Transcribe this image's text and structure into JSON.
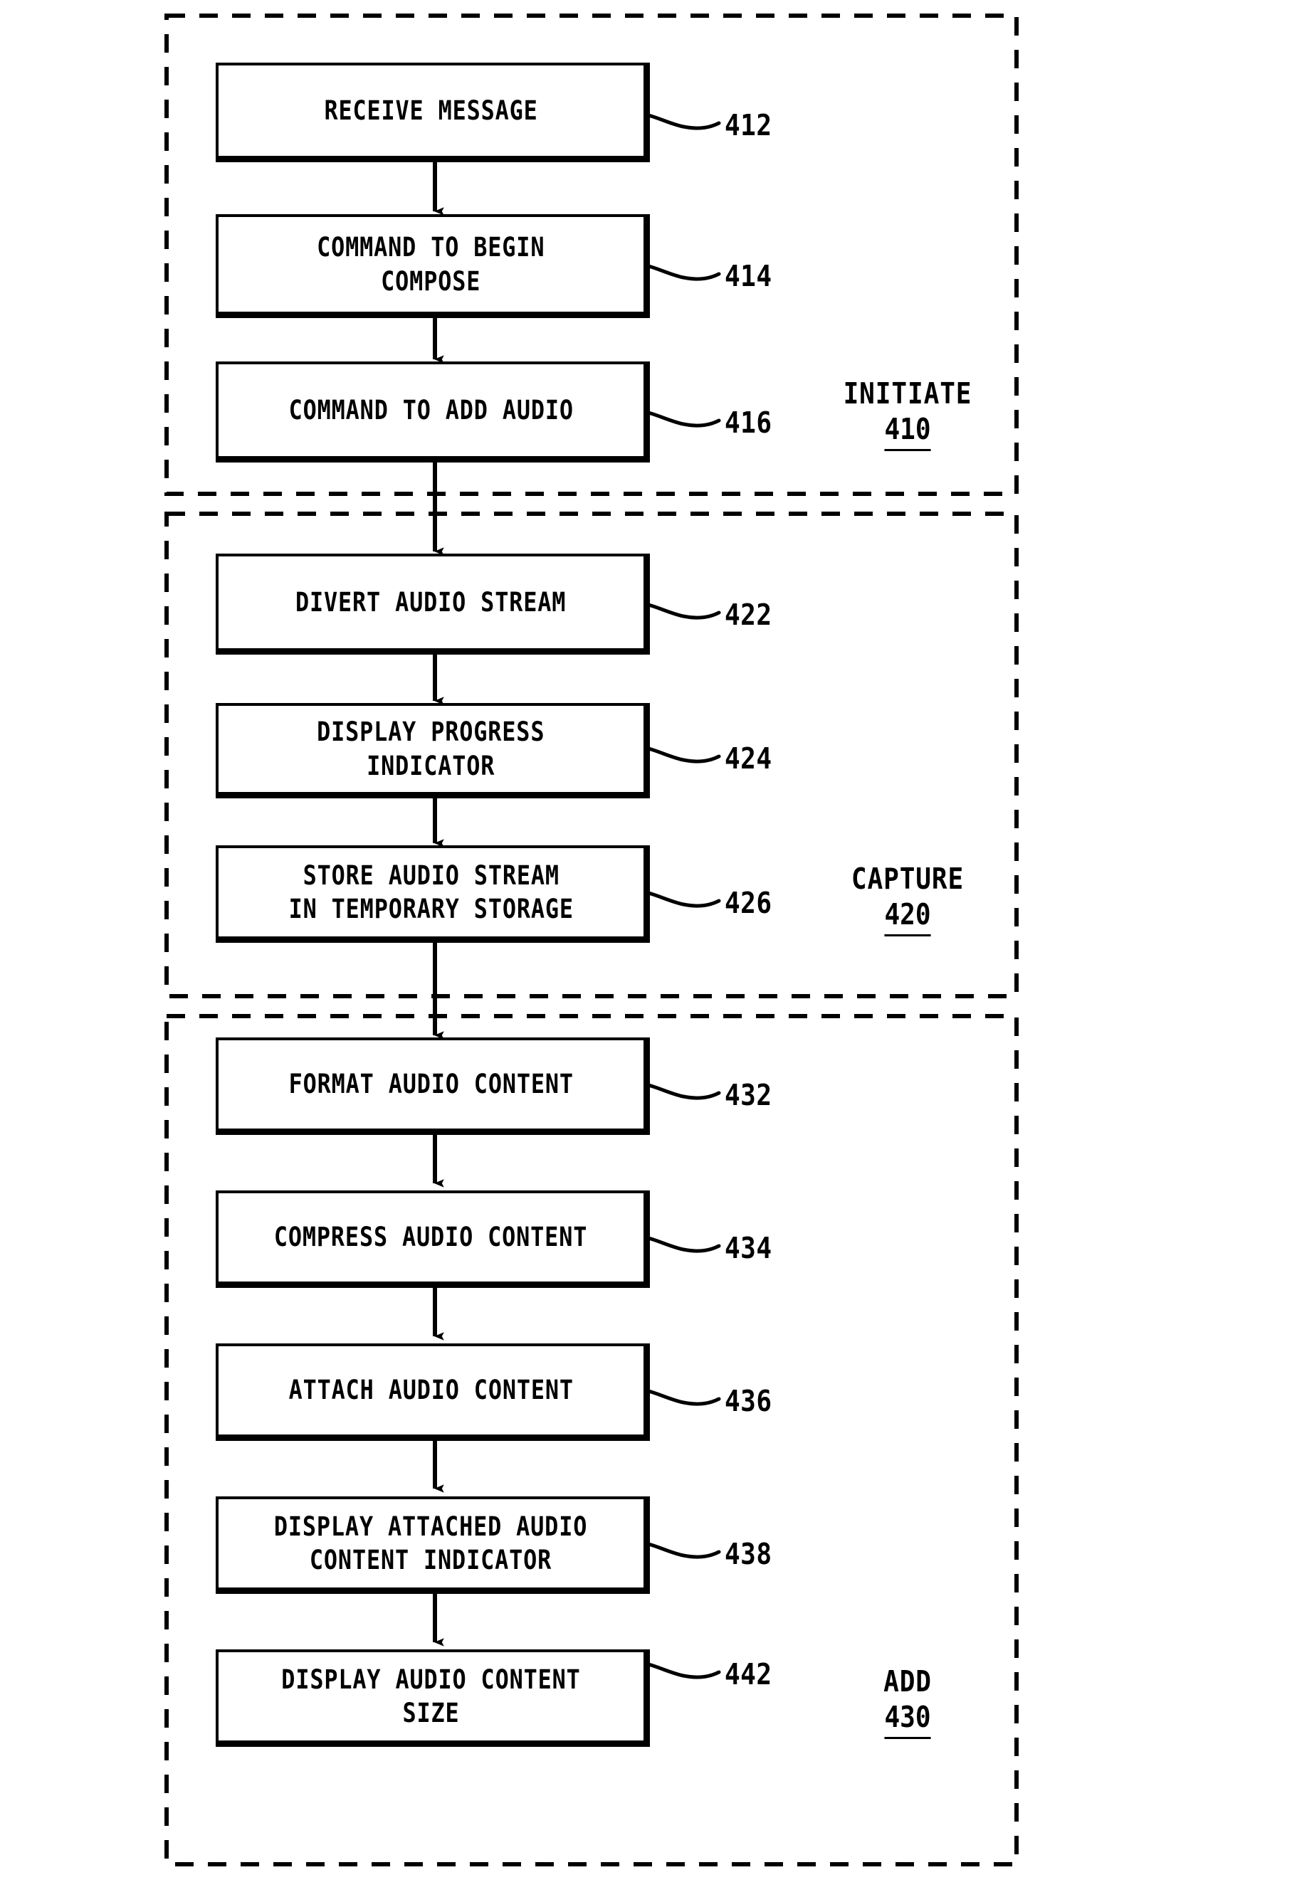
{
  "figure": {
    "type": "patent-flowchart",
    "orientation": "vertical",
    "background_color": "#ffffff",
    "line_color": "#000000"
  },
  "sections": [
    {
      "id": "initiate",
      "name": "INITIATE",
      "ref": "410",
      "steps": [
        "receive-message",
        "command-to-begin-compose",
        "command-to-add-audio"
      ]
    },
    {
      "id": "capture",
      "name": "CAPTURE",
      "ref": "420",
      "steps": [
        "divert-audio-stream",
        "display-progress-indicator",
        "store-audio-stream"
      ]
    },
    {
      "id": "add",
      "name": "ADD",
      "ref": "430",
      "steps": [
        "format-audio-content",
        "compress-audio-content",
        "attach-audio-content",
        "display-attached-indicator",
        "display-audio-content-size"
      ]
    }
  ],
  "steps": [
    {
      "id": "receive-message",
      "label": "RECEIVE MESSAGE",
      "ref": "412"
    },
    {
      "id": "command-to-begin-compose",
      "label": "COMMAND TO BEGIN\nCOMPOSE",
      "ref": "414"
    },
    {
      "id": "command-to-add-audio",
      "label": "COMMAND TO ADD AUDIO",
      "ref": "416"
    },
    {
      "id": "divert-audio-stream",
      "label": "DIVERT AUDIO STREAM",
      "ref": "422"
    },
    {
      "id": "display-progress-indicator",
      "label": "DISPLAY PROGRESS\nINDICATOR",
      "ref": "424"
    },
    {
      "id": "store-audio-stream",
      "label": "STORE AUDIO STREAM\nIN TEMPORARY STORAGE",
      "ref": "426"
    },
    {
      "id": "format-audio-content",
      "label": "FORMAT AUDIO CONTENT",
      "ref": "432"
    },
    {
      "id": "compress-audio-content",
      "label": "COMPRESS AUDIO CONTENT",
      "ref": "434"
    },
    {
      "id": "attach-audio-content",
      "label": "ATTACH AUDIO CONTENT",
      "ref": "436"
    },
    {
      "id": "display-attached-indicator",
      "label": "DISPLAY ATTACHED AUDIO\nCONTENT INDICATOR",
      "ref": "438"
    },
    {
      "id": "display-audio-content-size",
      "label": "DISPLAY AUDIO CONTENT SIZE",
      "ref": "442"
    }
  ],
  "flow_order": [
    "receive-message",
    "command-to-begin-compose",
    "command-to-add-audio",
    "divert-audio-stream",
    "display-progress-indicator",
    "store-audio-stream",
    "format-audio-content",
    "compress-audio-content",
    "attach-audio-content",
    "display-attached-indicator",
    "display-audio-content-size"
  ]
}
